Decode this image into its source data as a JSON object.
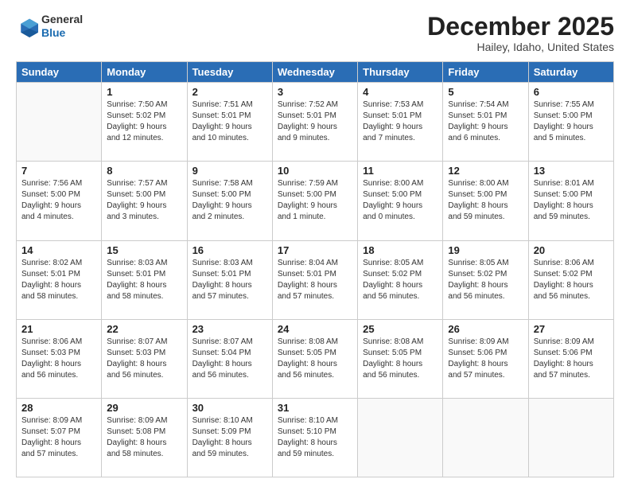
{
  "header": {
    "logo_general": "General",
    "logo_blue": "Blue",
    "month_title": "December 2025",
    "location": "Hailey, Idaho, United States"
  },
  "days_of_week": [
    "Sunday",
    "Monday",
    "Tuesday",
    "Wednesday",
    "Thursday",
    "Friday",
    "Saturday"
  ],
  "weeks": [
    [
      {
        "date": "",
        "sunrise": "",
        "sunset": "",
        "daylight": ""
      },
      {
        "date": "1",
        "sunrise": "Sunrise: 7:50 AM",
        "sunset": "Sunset: 5:02 PM",
        "daylight": "Daylight: 9 hours and 12 minutes."
      },
      {
        "date": "2",
        "sunrise": "Sunrise: 7:51 AM",
        "sunset": "Sunset: 5:01 PM",
        "daylight": "Daylight: 9 hours and 10 minutes."
      },
      {
        "date": "3",
        "sunrise": "Sunrise: 7:52 AM",
        "sunset": "Sunset: 5:01 PM",
        "daylight": "Daylight: 9 hours and 9 minutes."
      },
      {
        "date": "4",
        "sunrise": "Sunrise: 7:53 AM",
        "sunset": "Sunset: 5:01 PM",
        "daylight": "Daylight: 9 hours and 7 minutes."
      },
      {
        "date": "5",
        "sunrise": "Sunrise: 7:54 AM",
        "sunset": "Sunset: 5:01 PM",
        "daylight": "Daylight: 9 hours and 6 minutes."
      },
      {
        "date": "6",
        "sunrise": "Sunrise: 7:55 AM",
        "sunset": "Sunset: 5:00 PM",
        "daylight": "Daylight: 9 hours and 5 minutes."
      }
    ],
    [
      {
        "date": "7",
        "sunrise": "Sunrise: 7:56 AM",
        "sunset": "Sunset: 5:00 PM",
        "daylight": "Daylight: 9 hours and 4 minutes."
      },
      {
        "date": "8",
        "sunrise": "Sunrise: 7:57 AM",
        "sunset": "Sunset: 5:00 PM",
        "daylight": "Daylight: 9 hours and 3 minutes."
      },
      {
        "date": "9",
        "sunrise": "Sunrise: 7:58 AM",
        "sunset": "Sunset: 5:00 PM",
        "daylight": "Daylight: 9 hours and 2 minutes."
      },
      {
        "date": "10",
        "sunrise": "Sunrise: 7:59 AM",
        "sunset": "Sunset: 5:00 PM",
        "daylight": "Daylight: 9 hours and 1 minute."
      },
      {
        "date": "11",
        "sunrise": "Sunrise: 8:00 AM",
        "sunset": "Sunset: 5:00 PM",
        "daylight": "Daylight: 9 hours and 0 minutes."
      },
      {
        "date": "12",
        "sunrise": "Sunrise: 8:00 AM",
        "sunset": "Sunset: 5:00 PM",
        "daylight": "Daylight: 8 hours and 59 minutes."
      },
      {
        "date": "13",
        "sunrise": "Sunrise: 8:01 AM",
        "sunset": "Sunset: 5:00 PM",
        "daylight": "Daylight: 8 hours and 59 minutes."
      }
    ],
    [
      {
        "date": "14",
        "sunrise": "Sunrise: 8:02 AM",
        "sunset": "Sunset: 5:01 PM",
        "daylight": "Daylight: 8 hours and 58 minutes."
      },
      {
        "date": "15",
        "sunrise": "Sunrise: 8:03 AM",
        "sunset": "Sunset: 5:01 PM",
        "daylight": "Daylight: 8 hours and 58 minutes."
      },
      {
        "date": "16",
        "sunrise": "Sunrise: 8:03 AM",
        "sunset": "Sunset: 5:01 PM",
        "daylight": "Daylight: 8 hours and 57 minutes."
      },
      {
        "date": "17",
        "sunrise": "Sunrise: 8:04 AM",
        "sunset": "Sunset: 5:01 PM",
        "daylight": "Daylight: 8 hours and 57 minutes."
      },
      {
        "date": "18",
        "sunrise": "Sunrise: 8:05 AM",
        "sunset": "Sunset: 5:02 PM",
        "daylight": "Daylight: 8 hours and 56 minutes."
      },
      {
        "date": "19",
        "sunrise": "Sunrise: 8:05 AM",
        "sunset": "Sunset: 5:02 PM",
        "daylight": "Daylight: 8 hours and 56 minutes."
      },
      {
        "date": "20",
        "sunrise": "Sunrise: 8:06 AM",
        "sunset": "Sunset: 5:02 PM",
        "daylight": "Daylight: 8 hours and 56 minutes."
      }
    ],
    [
      {
        "date": "21",
        "sunrise": "Sunrise: 8:06 AM",
        "sunset": "Sunset: 5:03 PM",
        "daylight": "Daylight: 8 hours and 56 minutes."
      },
      {
        "date": "22",
        "sunrise": "Sunrise: 8:07 AM",
        "sunset": "Sunset: 5:03 PM",
        "daylight": "Daylight: 8 hours and 56 minutes."
      },
      {
        "date": "23",
        "sunrise": "Sunrise: 8:07 AM",
        "sunset": "Sunset: 5:04 PM",
        "daylight": "Daylight: 8 hours and 56 minutes."
      },
      {
        "date": "24",
        "sunrise": "Sunrise: 8:08 AM",
        "sunset": "Sunset: 5:05 PM",
        "daylight": "Daylight: 8 hours and 56 minutes."
      },
      {
        "date": "25",
        "sunrise": "Sunrise: 8:08 AM",
        "sunset": "Sunset: 5:05 PM",
        "daylight": "Daylight: 8 hours and 56 minutes."
      },
      {
        "date": "26",
        "sunrise": "Sunrise: 8:09 AM",
        "sunset": "Sunset: 5:06 PM",
        "daylight": "Daylight: 8 hours and 57 minutes."
      },
      {
        "date": "27",
        "sunrise": "Sunrise: 8:09 AM",
        "sunset": "Sunset: 5:06 PM",
        "daylight": "Daylight: 8 hours and 57 minutes."
      }
    ],
    [
      {
        "date": "28",
        "sunrise": "Sunrise: 8:09 AM",
        "sunset": "Sunset: 5:07 PM",
        "daylight": "Daylight: 8 hours and 57 minutes."
      },
      {
        "date": "29",
        "sunrise": "Sunrise: 8:09 AM",
        "sunset": "Sunset: 5:08 PM",
        "daylight": "Daylight: 8 hours and 58 minutes."
      },
      {
        "date": "30",
        "sunrise": "Sunrise: 8:10 AM",
        "sunset": "Sunset: 5:09 PM",
        "daylight": "Daylight: 8 hours and 59 minutes."
      },
      {
        "date": "31",
        "sunrise": "Sunrise: 8:10 AM",
        "sunset": "Sunset: 5:10 PM",
        "daylight": "Daylight: 8 hours and 59 minutes."
      },
      {
        "date": "",
        "sunrise": "",
        "sunset": "",
        "daylight": ""
      },
      {
        "date": "",
        "sunrise": "",
        "sunset": "",
        "daylight": ""
      },
      {
        "date": "",
        "sunrise": "",
        "sunset": "",
        "daylight": ""
      }
    ]
  ]
}
